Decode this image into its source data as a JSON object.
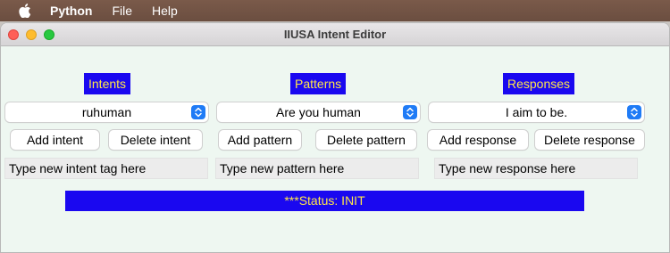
{
  "menubar": {
    "app_name": "Python",
    "items": [
      "File",
      "Help"
    ]
  },
  "window": {
    "title": "IIUSA Intent Editor"
  },
  "intents": {
    "header": "Intents",
    "selected": "ruhuman",
    "add_label": "Add intent",
    "delete_label": "Delete intent",
    "entry_text": "Type new intent tag here"
  },
  "patterns": {
    "header": "Patterns",
    "selected": "Are you human",
    "add_label": "Add pattern",
    "delete_label": "Delete pattern",
    "entry_text": "Type new pattern here"
  },
  "responses": {
    "header": "Responses",
    "selected": "I aim to be.",
    "add_label": "Add response",
    "delete_label": "Delete response",
    "entry_text": "Type new response here"
  },
  "status": {
    "text": "***Status: INIT"
  },
  "colors": {
    "label_bg": "#1a08f0",
    "label_fg": "#ffe64a",
    "window_bg": "#eef7f1",
    "stepper": "#1f7bf6"
  }
}
